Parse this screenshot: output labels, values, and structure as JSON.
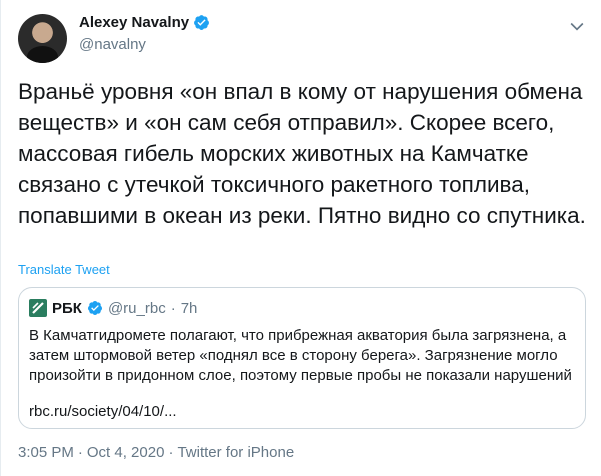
{
  "author": {
    "display_name": "Alexey Navalny",
    "handle": "@navalny"
  },
  "tweet": {
    "text": "Враньё уровня «он впал в кому от нарушения обмена веществ» и «он сам себя отправил». Скорее всего, массовая гибель морских животных на Камчатке связано с утечкой токсичного ракетного топлива, попавшими в океан из реки. Пятно видно со спутника.",
    "translate_label": "Translate Tweet"
  },
  "quote": {
    "name": "РБК",
    "handle": "@ru_rbc",
    "separator": "·",
    "time": "7h",
    "text": "В Камчатгидромете полагают, что прибрежная акватория была загрязнена, а затем штормовой ветер «поднял все в сторону берега». Загрязнение могло произойти в придонном слое, поэтому первые пробы не показали нарушений",
    "link": "rbc.ru/society/04/10/..."
  },
  "meta": {
    "time": "3:05 PM",
    "separator1": "·",
    "date": "Oct 4, 2020",
    "separator2": "·",
    "source": "Twitter for iPhone"
  },
  "colors": {
    "link_blue": "#1da1f2",
    "verified_blue": "#1da1f2",
    "secondary_text": "#657786",
    "border": "#ccd6dd"
  },
  "icons": {
    "verified": "verified-badge-icon",
    "caret": "chevron-down-icon",
    "rbc_logo": "rbc-logo-icon"
  }
}
